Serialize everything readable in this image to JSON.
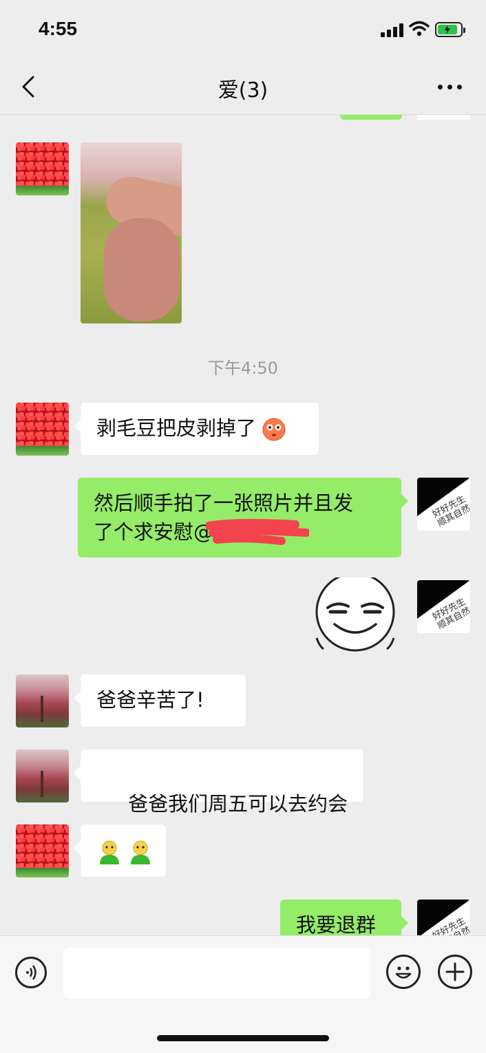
{
  "status_bar": {
    "time": "4:55"
  },
  "nav": {
    "title": "爱(3)"
  },
  "timestamp": "下午4:50",
  "messages": {
    "m1": "剥毛豆把皮剥掉了",
    "m2_line1": "然后顺手拍了一张照片并且发",
    "m2_line2": "了个求安慰@",
    "m3": "爸爸辛苦了!",
    "m4": " 爸爸我们周五可以去约会",
    "m6": "我要退群"
  },
  "avatar_signature": "好好先生 顺其自然",
  "colors": {
    "bubble_self": "#95ec69",
    "bubble_other": "#ffffff",
    "background": "#ededed"
  },
  "icons": [
    "back-icon",
    "more-icon",
    "voice-icon",
    "emoji-icon",
    "plus-icon"
  ]
}
